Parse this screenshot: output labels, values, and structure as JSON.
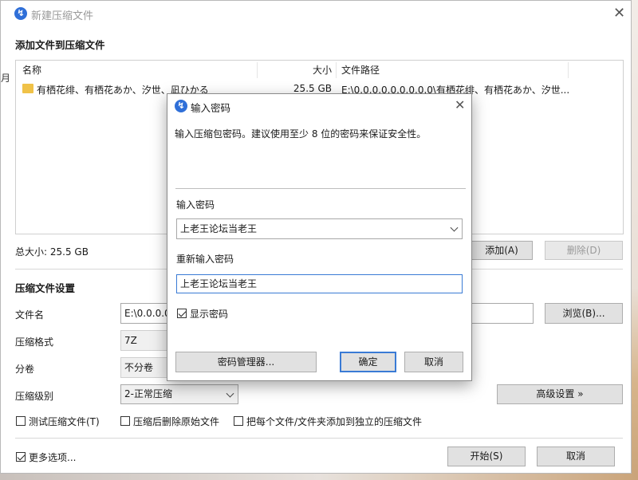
{
  "window": {
    "title": "新建压缩文件",
    "section_add": "添加文件到压缩文件",
    "list": {
      "col_name": "名称",
      "col_size": "大小",
      "col_path": "文件路径",
      "rows": [
        {
          "name": "有栖花绯、有栖花あか、汐世、凪ひかる",
          "size": "25.5 GB",
          "path": "E:\\0.0.0.0.0.0.0.0.0\\有栖花绯、有栖花あか、汐世..."
        }
      ]
    },
    "total_size": "总大小: 25.5 GB",
    "add_button": "添加(A)",
    "delete_button": "删除(D)",
    "section_settings": "压缩文件设置",
    "filename_label": "文件名",
    "filename_value": "E:\\0.0.0.0.",
    "browse_button": "浏览(B)...",
    "format_label": "压缩格式",
    "format_value": "7Z",
    "split_label": "分卷",
    "split_value": "不分卷",
    "level_label": "压缩级别",
    "level_value": "2-正常压缩",
    "advanced_button": "高级设置 »",
    "test_archive": "测试压缩文件(T)",
    "delete_after": "压缩后删除原始文件",
    "each_separate": "把每个文件/文件夹添加到独立的压缩文件",
    "more_options": "更多选项...",
    "start_button": "开始(S)",
    "cancel_button": "取消",
    "left_edge_char": "月"
  },
  "dialog": {
    "title": "输入密码",
    "hint": "输入压缩包密码。建议使用至少 8 位的密码来保证安全性。",
    "pw_label": "输入密码",
    "pw_value": "上老王论坛当老王",
    "repw_label": "重新输入密码",
    "repw_value": "上老王论坛当老王",
    "show_password": "显示密码",
    "manager_button": "密码管理器...",
    "ok_button": "确定",
    "cancel_button": "取消"
  },
  "colors": {
    "accent": "#3a7bd5",
    "folder": "#f0c248"
  }
}
